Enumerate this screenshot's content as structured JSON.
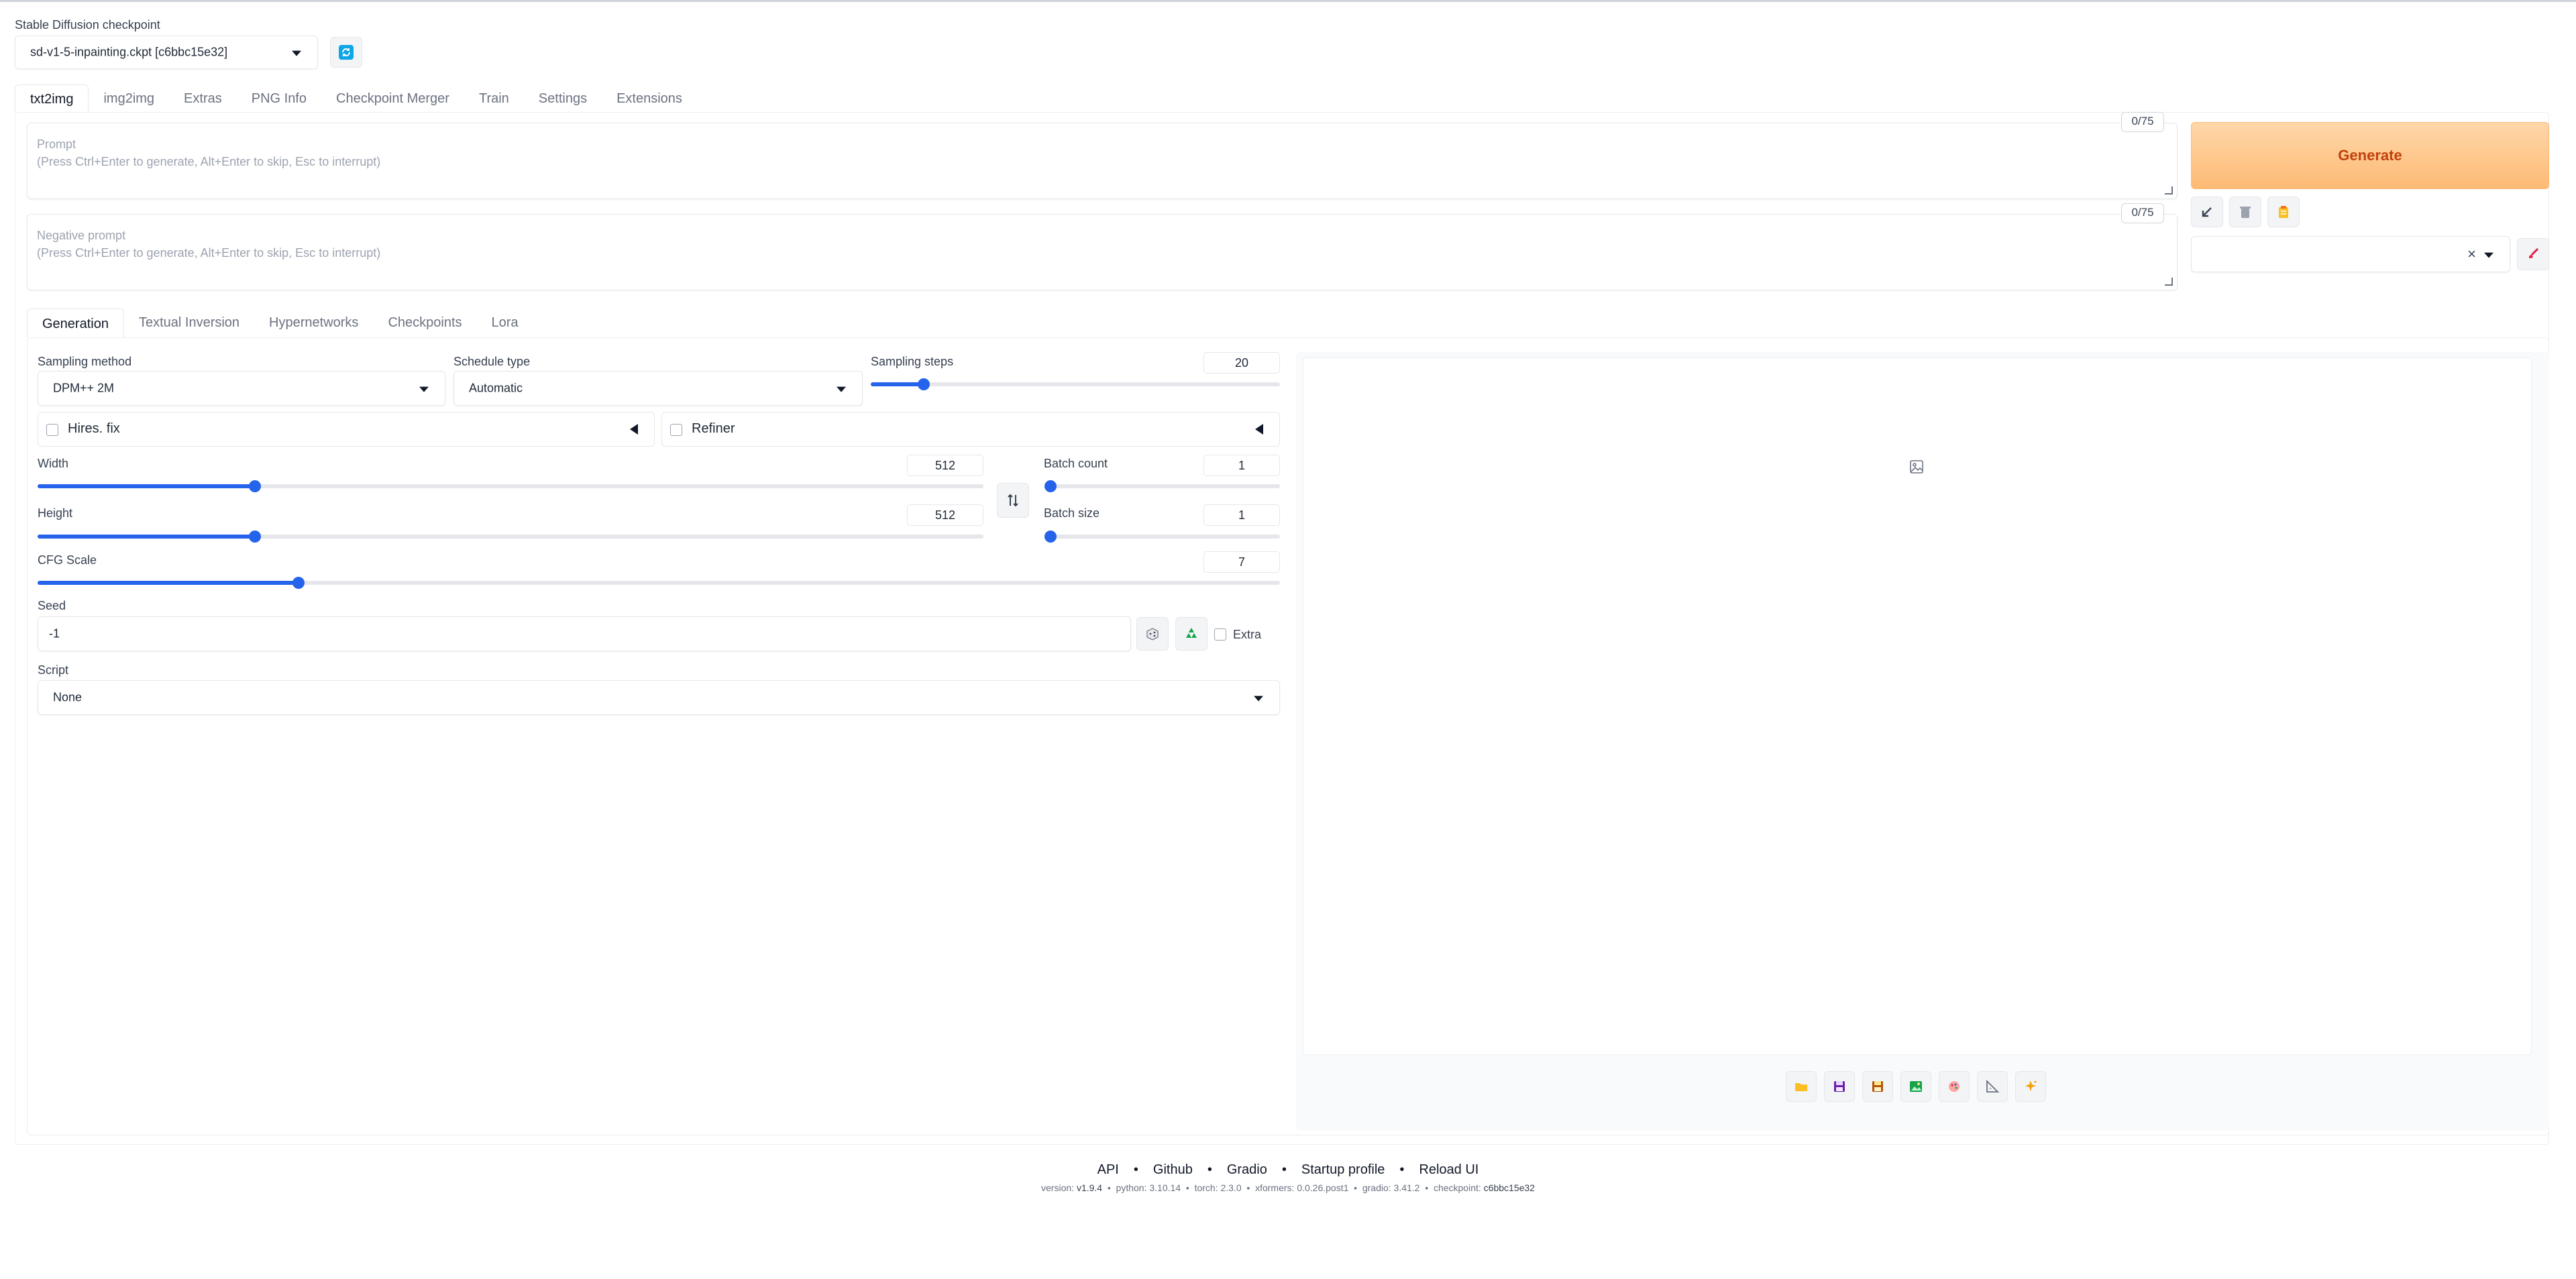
{
  "checkpoint": {
    "label": "Stable Diffusion checkpoint",
    "value": "sd-v1-5-inpainting.ckpt [c6bbc15e32]"
  },
  "main_tabs": [
    {
      "label": "txt2img",
      "active": true
    },
    {
      "label": "img2img"
    },
    {
      "label": "Extras"
    },
    {
      "label": "PNG Info"
    },
    {
      "label": "Checkpoint Merger"
    },
    {
      "label": "Train"
    },
    {
      "label": "Settings"
    },
    {
      "label": "Extensions"
    }
  ],
  "prompt": {
    "label": "Prompt",
    "placeholder": "(Press Ctrl+Enter to generate, Alt+Enter to skip, Esc to interrupt)",
    "counter": "0/75"
  },
  "negative_prompt": {
    "label": "Negative prompt",
    "placeholder": "(Press Ctrl+Enter to generate, Alt+Enter to skip, Esc to interrupt)",
    "counter": "0/75"
  },
  "generate": {
    "label": "Generate",
    "color": "#ea580c"
  },
  "sub_tabs": [
    {
      "label": "Generation",
      "active": true
    },
    {
      "label": "Textual Inversion"
    },
    {
      "label": "Hypernetworks"
    },
    {
      "label": "Checkpoints"
    },
    {
      "label": "Lora"
    }
  ],
  "sampling_method": {
    "label": "Sampling method",
    "value": "DPM++ 2M"
  },
  "schedule_type": {
    "label": "Schedule type",
    "value": "Automatic"
  },
  "sampling_steps": {
    "label": "Sampling steps",
    "value": "20",
    "fraction": 0.13
  },
  "hires_fix": {
    "label": "Hires. fix"
  },
  "refiner": {
    "label": "Refiner"
  },
  "width": {
    "label": "Width",
    "value": "512",
    "fraction": 0.23
  },
  "height": {
    "label": "Height",
    "value": "512",
    "fraction": 0.23
  },
  "batch_count": {
    "label": "Batch count",
    "value": "1",
    "fraction": 0.0
  },
  "batch_size": {
    "label": "Batch size",
    "value": "1",
    "fraction": 0.0
  },
  "cfg_scale": {
    "label": "CFG Scale",
    "value": "7",
    "fraction": 0.21
  },
  "seed": {
    "label": "Seed",
    "value": "-1",
    "extra_label": "Extra"
  },
  "script": {
    "label": "Script",
    "value": "None"
  },
  "footer": {
    "links": [
      "API",
      "Github",
      "Gradio",
      "Startup profile",
      "Reload UI"
    ],
    "version_label": "version:",
    "version": "v1.9.4",
    "python_label": "python:",
    "python": "3.10.14",
    "torch_label": "torch:",
    "torch": "2.3.0",
    "xformers_label": "xformers:",
    "xformers": "0.0.26.post1",
    "gradio_label": "gradio:",
    "gradio": "3.41.2",
    "checkpoint_label": "checkpoint:",
    "checkpoint": "c6bbc15e32"
  },
  "icons": [
    "refresh-icon",
    "arrow-icon",
    "trash-icon",
    "clipboard-icon",
    "close-icon",
    "brush-icon",
    "swap-icon",
    "dice-icon",
    "recycle-icon",
    "image-icon",
    "folder-icon",
    "save-icon",
    "zip-icon",
    "send-to-img2img-icon",
    "send-to-inpaint-icon",
    "send-to-extras-icon",
    "sparkle-icon"
  ]
}
